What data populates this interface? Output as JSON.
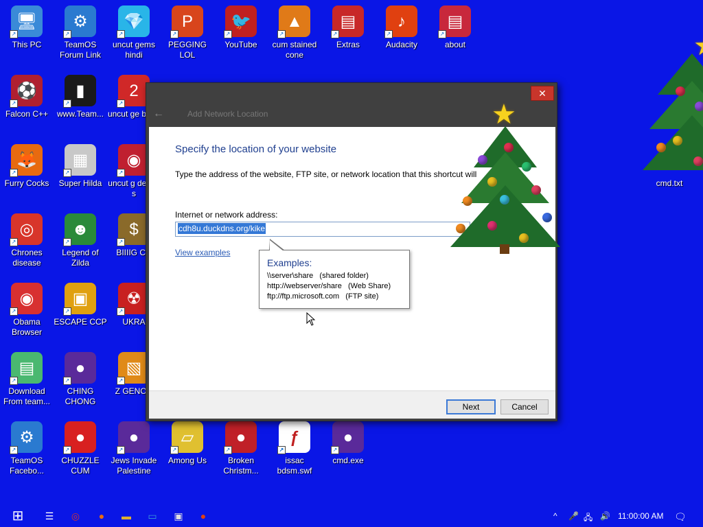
{
  "desktop": {
    "icons": [
      {
        "name": "this-pc-icon",
        "label": "This PC",
        "glyph": "🖥",
        "color": "#3a8ad8"
      },
      {
        "name": "teamos-forum-link-icon",
        "label": "TeamOS Forum Link",
        "glyph": "⚙",
        "color": "#2a7ad0"
      },
      {
        "name": "uncut-gems-hindi-icon",
        "label": "uncut gems hindi",
        "glyph": "💎",
        "color": "#29b5e8"
      },
      {
        "name": "pegging-lol-icon",
        "label": "PEGGING LOL",
        "glyph": "P",
        "color": "#d8451c"
      },
      {
        "name": "youtube-icon",
        "label": "YouTube",
        "glyph": "🐦",
        "color": "#c02020"
      },
      {
        "name": "cum-stained-cone-icon",
        "label": "cum stained cone",
        "glyph": "▲",
        "color": "#e07a18"
      },
      {
        "name": "extras-icon",
        "label": "Extras",
        "glyph": "▤",
        "color": "#c82828"
      },
      {
        "name": "audacity-icon",
        "label": "Audacity",
        "glyph": "♪",
        "color": "#e04010"
      },
      {
        "name": "about-icon",
        "label": "about",
        "glyph": "▤",
        "color": "#c8283c"
      },
      {
        "name": "falcon-cpp-icon",
        "label": "Falcon C++",
        "glyph": "⚽",
        "color": "#b02030"
      },
      {
        "name": "teamos-exe-icon",
        "label": "www.Team...",
        "glyph": "▮",
        "color": "#1a1a1a"
      },
      {
        "name": "uncut-gems-bang-icon",
        "label": "uncut ge bang",
        "glyph": "2",
        "color": "#d02828"
      },
      {
        "name": "furry-cocks-icon",
        "label": "Furry Cocks",
        "glyph": "🦊",
        "color": "#e86a10"
      },
      {
        "name": "super-hilda-icon",
        "label": "Super Hilda",
        "glyph": "▦",
        "color": "#c8c8c8"
      },
      {
        "name": "uncut-gems-delete-icon",
        "label": "uncut g delete s",
        "glyph": "◉",
        "color": "#c02030"
      },
      {
        "name": "chrome-disease-icon",
        "label": "Chrones disease",
        "glyph": "◎",
        "color": "#d8352a"
      },
      {
        "name": "legend-of-zilda-icon",
        "label": "Legend of Zilda",
        "glyph": "☻",
        "color": "#2a8a3a"
      },
      {
        "name": "billig-cum-icon",
        "label": "BIIIIG CU",
        "glyph": "$",
        "color": "#8a6a2a"
      },
      {
        "name": "obama-browser-icon",
        "label": "Obama Browser",
        "glyph": "◉",
        "color": "#d83030"
      },
      {
        "name": "escape-ccp-icon",
        "label": "ESCAPE CCP",
        "glyph": "▣",
        "color": "#e0a010"
      },
      {
        "name": "ukraine-icon",
        "label": "UKRA",
        "glyph": "☢",
        "color": "#c82020"
      },
      {
        "name": "download-from-team-icon",
        "label": "Download From team...",
        "glyph": "▤",
        "color": "#4ab870"
      },
      {
        "name": "ching-chong-icon",
        "label": "CHING CHONG",
        "glyph": "●",
        "color": "#5a2a9a"
      },
      {
        "name": "z-genocide-icon",
        "label": "Z GENOC",
        "glyph": "▧",
        "color": "#e08a18"
      },
      {
        "name": "teamos-facebook-icon",
        "label": "TeamOS Facebo...",
        "glyph": "⚙",
        "color": "#2a7ad0"
      },
      {
        "name": "chuzzle-cum-icon",
        "label": "CHUZZLE CUM",
        "glyph": "●",
        "color": "#d82020"
      },
      {
        "name": "jews-invade-palestine-icon",
        "label": "Jews Invade Palestine",
        "glyph": "●",
        "color": "#5a2a9a"
      },
      {
        "name": "among-us-icon",
        "label": "Among Us",
        "glyph": "▱",
        "color": "#e0c030"
      },
      {
        "name": "broken-christmas-icon",
        "label": "Broken Christm...",
        "glyph": "●",
        "color": "#c02028"
      },
      {
        "name": "issac-bdsm-swf-icon",
        "label": "issac bdsm.swf",
        "glyph": "ƒ",
        "color": "#ffffff"
      },
      {
        "name": "cmd-exe-icon",
        "label": "cmd.exe",
        "glyph": "●",
        "color": "#5a2a9a"
      },
      {
        "name": "cmd-txt-icon",
        "label": "cmd.txt",
        "glyph": "",
        "color": "#0a16e6"
      }
    ]
  },
  "dialog": {
    "title": "Add Network Location",
    "close_glyph": "✕",
    "back_glyph": "←",
    "heading": "Specify the location of your website",
    "description": "Type the address of the website, FTP site, or network location that this shortcut will open.",
    "address_label": "Internet or network address:",
    "address_value": "cdh8u.duckdns.org/kike",
    "view_examples": "View examples",
    "next_label": "Next",
    "cancel_label": "Cancel"
  },
  "tooltip": {
    "title": "Examples:",
    "lines": [
      "\\\\server\\share   (shared folder)",
      "http://webserver/share   (Web Share)",
      "ftp://ftp.microsoft.com   (FTP site)"
    ]
  },
  "taskbar": {
    "start_glyph": "⊞",
    "items": [
      {
        "name": "task-view-icon",
        "glyph": "☰"
      },
      {
        "name": "chrome-taskbar-icon",
        "glyph": "◎"
      },
      {
        "name": "firefox-taskbar-icon",
        "glyph": "●"
      },
      {
        "name": "file-explorer-taskbar-icon",
        "glyph": "▬"
      },
      {
        "name": "window-taskbar-icon",
        "glyph": "▭"
      },
      {
        "name": "network-location-taskbar-icon",
        "glyph": "▣"
      },
      {
        "name": "audacity-taskbar-icon",
        "glyph": "●"
      }
    ],
    "tray": {
      "chevron": "^",
      "mic": "🎤",
      "network": "🖧",
      "volume": "🔊",
      "time": "11:00:00 AM",
      "notification": "🗨"
    }
  }
}
